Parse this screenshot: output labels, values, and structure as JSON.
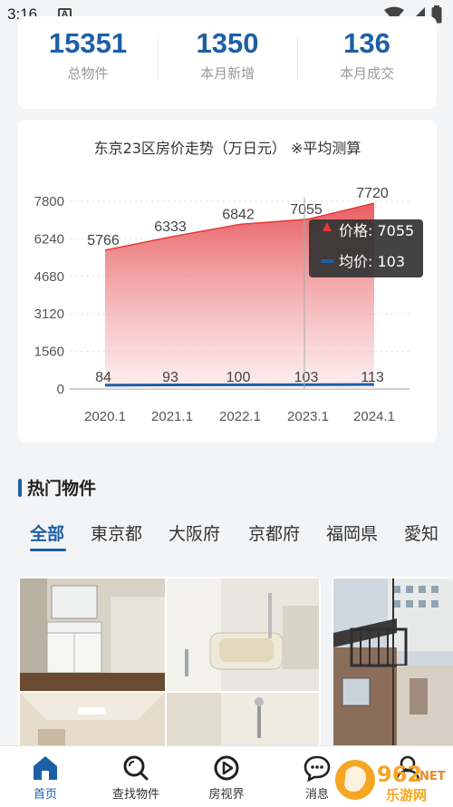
{
  "status_bar": {
    "time": "3:16",
    "notif_letter": "A"
  },
  "stats": [
    {
      "value": "15351",
      "label": "总物件"
    },
    {
      "value": "1350",
      "label": "本月新增"
    },
    {
      "value": "136",
      "label": "本月成交"
    }
  ],
  "chart_title": "东京23区房价走势（万日元） ※平均测算",
  "chart_data": {
    "type": "area",
    "x": [
      "2020.1",
      "2021.1",
      "2022.1",
      "2023.1",
      "2024.1"
    ],
    "ylim": [
      0,
      7800
    ],
    "yticks": [
      "0",
      "1560",
      "3120",
      "4680",
      "6240",
      "7800"
    ],
    "series": [
      {
        "name": "价格",
        "values": [
          5766,
          6333,
          6842,
          7055,
          7720
        ],
        "color": "#e53935"
      },
      {
        "name": "均价",
        "values": [
          84,
          93,
          100,
          103,
          113
        ],
        "color": "#1d5fa6"
      }
    ],
    "tooltip": {
      "category_index": 3,
      "price_label": "价格: 7055",
      "avg_label": "均价: 103"
    },
    "grid": true
  },
  "section_title": "热门物件",
  "tabs": [
    "全部",
    "東京都",
    "大阪府",
    "京都府",
    "福岡県",
    "愛知"
  ],
  "active_tab": 0,
  "nav": [
    {
      "label": "首页",
      "icon": "home-icon",
      "active": true
    },
    {
      "label": "查找物件",
      "icon": "search-icon",
      "active": false
    },
    {
      "label": "房视界",
      "icon": "video-play-icon",
      "active": false
    },
    {
      "label": "消息",
      "icon": "message-icon",
      "active": false
    },
    {
      "label": "",
      "icon": "user-icon",
      "active": false
    }
  ],
  "watermark": {
    "text_top": "962",
    "text_net": ".NET",
    "text_bottom": "乐游网"
  }
}
